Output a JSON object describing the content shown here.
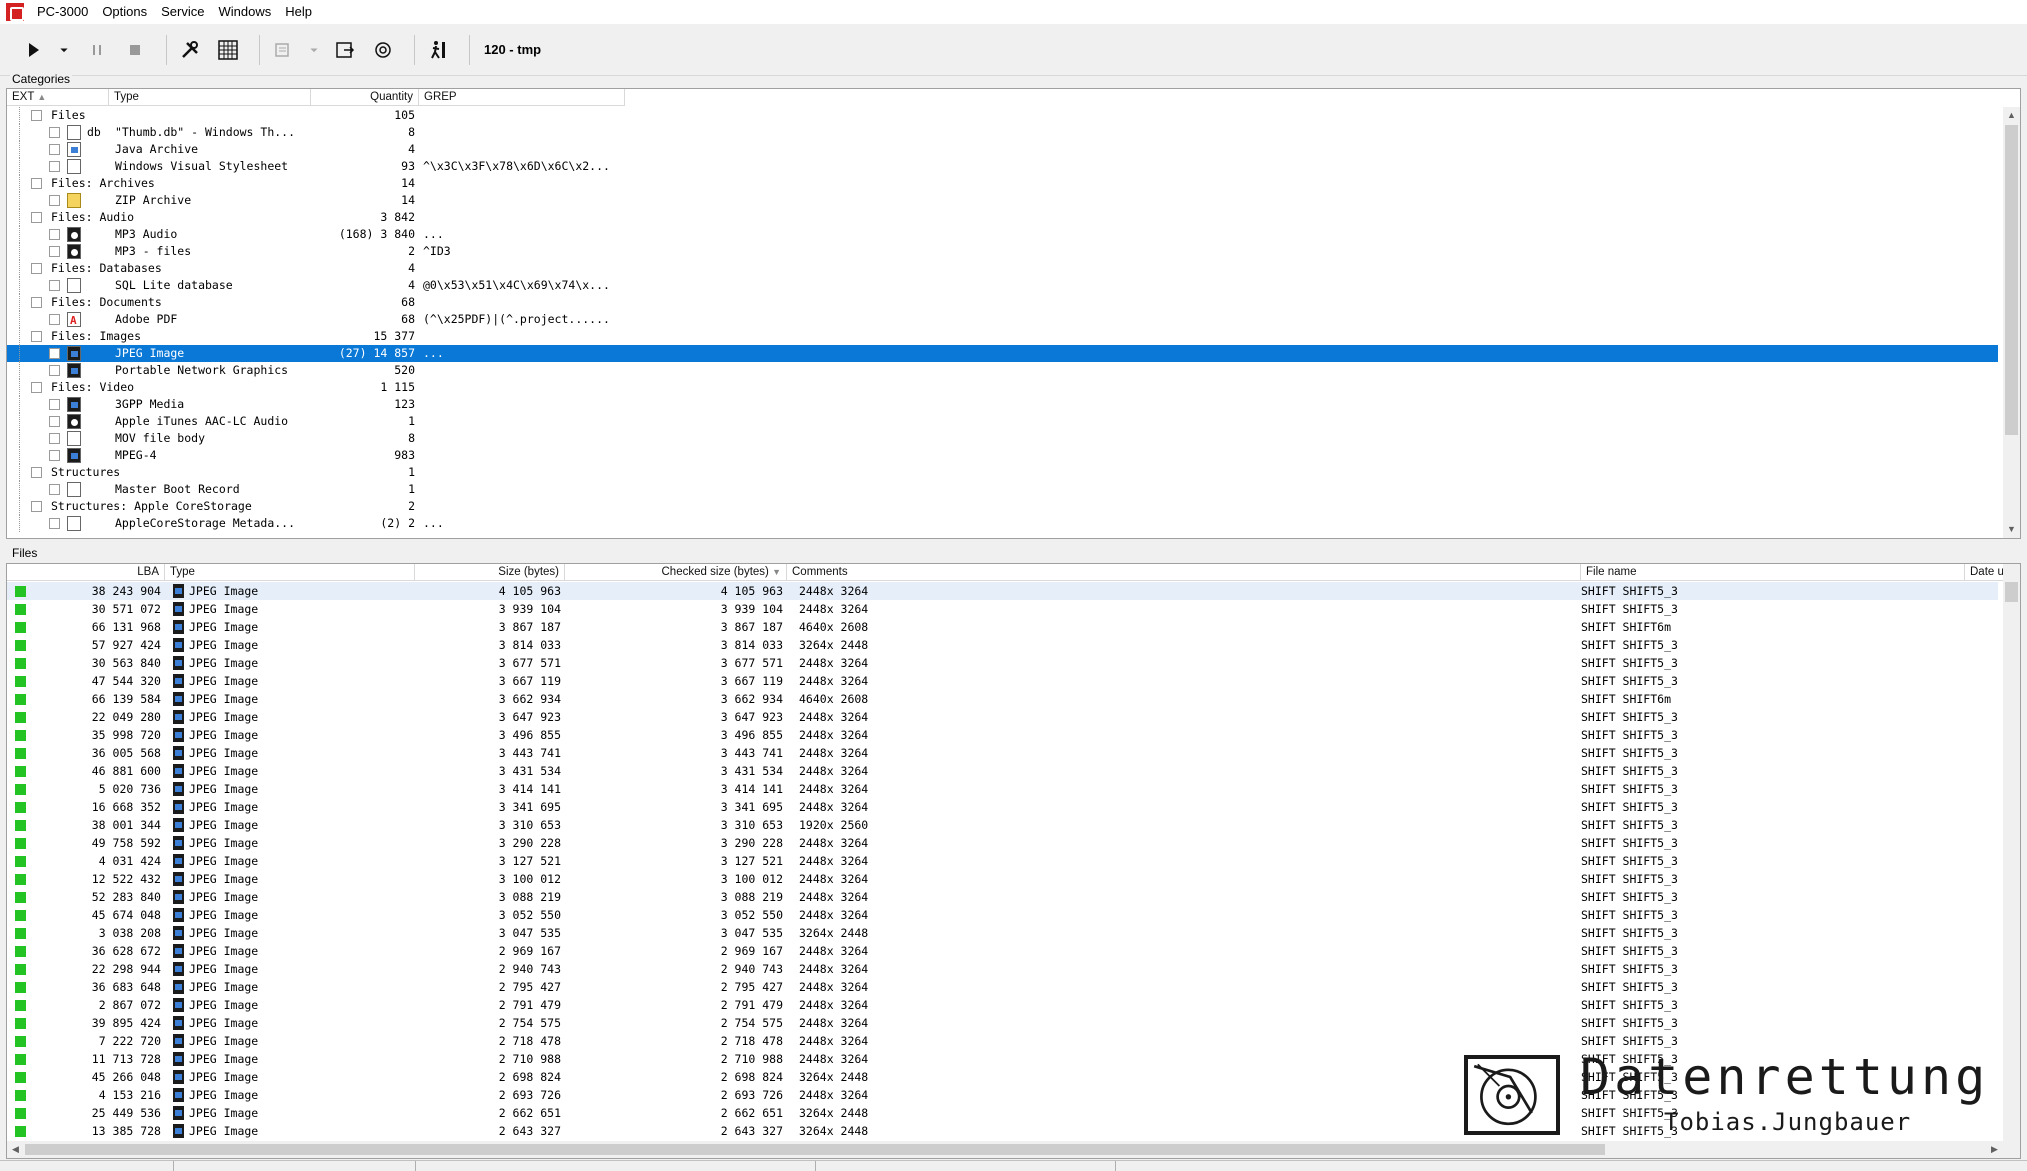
{
  "app": {
    "title": "PC-3000",
    "menu": [
      "Options",
      "Service",
      "Windows",
      "Help"
    ]
  },
  "toolbar": {
    "label": "120 - tmp",
    "icons": [
      "play-icon",
      "dropdown-arrow-icon",
      "pause-icon",
      "stop-icon",
      "tools-icon",
      "grid-icon",
      "list-tool-icon",
      "export-icon",
      "search-config-icon",
      "runner-icon"
    ]
  },
  "categories": {
    "group_title": "Categories",
    "columns": [
      "EXT",
      "Type",
      "Quantity",
      "GREP"
    ],
    "rows": [
      {
        "level": 0,
        "label": "Files",
        "qty": "105",
        "grep": ""
      },
      {
        "level": 1,
        "ext": "db",
        "label": "\"Thumb.db\" - Windows Th...",
        "qty": "8",
        "grep": "",
        "icon": "plain"
      },
      {
        "level": 1,
        "ext": "",
        "label": "Java Archive",
        "qty": "4",
        "grep": "",
        "icon": "java"
      },
      {
        "level": 1,
        "ext": "",
        "label": "Windows Visual Stylesheet",
        "qty": "93",
        "grep": "^\\x3C\\x3F\\x78\\x6D\\x6C\\x2...",
        "icon": "plain"
      },
      {
        "level": 0,
        "label": "Files: Archives",
        "qty": "14",
        "grep": ""
      },
      {
        "level": 1,
        "ext": "",
        "label": "ZIP Archive",
        "qty": "14",
        "grep": "",
        "icon": "zip"
      },
      {
        "level": 0,
        "label": "Files: Audio",
        "qty": "3 842",
        "grep": ""
      },
      {
        "level": 1,
        "ext": "",
        "label": "MP3 Audio",
        "qty": "(168) 3 840",
        "grep": "...",
        "icon": "audio"
      },
      {
        "level": 1,
        "ext": "",
        "label": "MP3 - files",
        "qty": "2",
        "grep": "^ID3",
        "icon": "audio"
      },
      {
        "level": 0,
        "label": "Files: Databases",
        "qty": "4",
        "grep": ""
      },
      {
        "level": 1,
        "ext": "",
        "label": "SQL Lite database",
        "qty": "4",
        "grep": "@0\\x53\\x51\\x4C\\x69\\x74\\x...",
        "icon": "plain"
      },
      {
        "level": 0,
        "label": "Files: Documents",
        "qty": "68",
        "grep": ""
      },
      {
        "level": 1,
        "ext": "",
        "label": "Adobe PDF",
        "qty": "68",
        "grep": "(^\\x25PDF)|(^.project......",
        "icon": "pdf"
      },
      {
        "level": 0,
        "label": "Files: Images",
        "qty": "15 377",
        "grep": ""
      },
      {
        "level": 1,
        "ext": "",
        "label": "JPEG Image",
        "qty": "(27) 14 857",
        "grep": "...",
        "icon": "image",
        "selected": true
      },
      {
        "level": 1,
        "ext": "",
        "label": "Portable Network Graphics",
        "qty": "520",
        "grep": "",
        "icon": "image"
      },
      {
        "level": 0,
        "label": "Files: Video",
        "qty": "1 115",
        "grep": ""
      },
      {
        "level": 1,
        "ext": "",
        "label": "3GPP Media",
        "qty": "123",
        "grep": "",
        "icon": "image"
      },
      {
        "level": 1,
        "ext": "",
        "label": "Apple iTunes AAC-LC Audio",
        "qty": "1",
        "grep": "",
        "icon": "audio"
      },
      {
        "level": 1,
        "ext": "",
        "label": "MOV file body",
        "qty": "8",
        "grep": "",
        "icon": "plain"
      },
      {
        "level": 1,
        "ext": "",
        "label": "MPEG-4",
        "qty": "983",
        "grep": "",
        "icon": "image"
      },
      {
        "level": 0,
        "label": "Structures",
        "qty": "1",
        "grep": ""
      },
      {
        "level": 1,
        "ext": "",
        "label": "Master Boot Record",
        "qty": "1",
        "grep": "",
        "icon": "plain"
      },
      {
        "level": 0,
        "label": "Structures: Apple CoreStorage",
        "qty": "2",
        "grep": ""
      },
      {
        "level": 1,
        "ext": "",
        "label": "AppleCoreStorage Metada...",
        "qty": "(2) 2",
        "grep": "...",
        "icon": "plain"
      }
    ]
  },
  "files": {
    "group_title": "Files",
    "columns": [
      "LBA",
      "Type",
      "Size (bytes)",
      "Checked size (bytes)",
      "Comments",
      "File name",
      "Date u"
    ],
    "rows": [
      [
        "38 243 904",
        "JPEG Image",
        "4 105 963",
        "4 105 963",
        "2448x 3264",
        "SHIFT SHIFT5_3"
      ],
      [
        "30 571 072",
        "JPEG Image",
        "3 939 104",
        "3 939 104",
        "2448x 3264",
        "SHIFT SHIFT5_3"
      ],
      [
        "66 131 968",
        "JPEG Image",
        "3 867 187",
        "3 867 187",
        "4640x 2608",
        "SHIFT SHIFT6m"
      ],
      [
        "57 927 424",
        "JPEG Image",
        "3 814 033",
        "3 814 033",
        "3264x 2448",
        "SHIFT SHIFT5_3"
      ],
      [
        "30 563 840",
        "JPEG Image",
        "3 677 571",
        "3 677 571",
        "2448x 3264",
        "SHIFT SHIFT5_3"
      ],
      [
        "47 544 320",
        "JPEG Image",
        "3 667 119",
        "3 667 119",
        "2448x 3264",
        "SHIFT SHIFT5_3"
      ],
      [
        "66 139 584",
        "JPEG Image",
        "3 662 934",
        "3 662 934",
        "4640x 2608",
        "SHIFT SHIFT6m"
      ],
      [
        "22 049 280",
        "JPEG Image",
        "3 647 923",
        "3 647 923",
        "2448x 3264",
        "SHIFT SHIFT5_3"
      ],
      [
        "35 998 720",
        "JPEG Image",
        "3 496 855",
        "3 496 855",
        "2448x 3264",
        "SHIFT SHIFT5_3"
      ],
      [
        "36 005 568",
        "JPEG Image",
        "3 443 741",
        "3 443 741",
        "2448x 3264",
        "SHIFT SHIFT5_3"
      ],
      [
        "46 881 600",
        "JPEG Image",
        "3 431 534",
        "3 431 534",
        "2448x 3264",
        "SHIFT SHIFT5_3"
      ],
      [
        "5 020 736",
        "JPEG Image",
        "3 414 141",
        "3 414 141",
        "2448x 3264",
        "SHIFT SHIFT5_3"
      ],
      [
        "16 668 352",
        "JPEG Image",
        "3 341 695",
        "3 341 695",
        "2448x 3264",
        "SHIFT SHIFT5_3"
      ],
      [
        "38 001 344",
        "JPEG Image",
        "3 310 653",
        "3 310 653",
        "1920x 2560",
        "SHIFT SHIFT5_3"
      ],
      [
        "49 758 592",
        "JPEG Image",
        "3 290 228",
        "3 290 228",
        "2448x 3264",
        "SHIFT SHIFT5_3"
      ],
      [
        "4 031 424",
        "JPEG Image",
        "3 127 521",
        "3 127 521",
        "2448x 3264",
        "SHIFT SHIFT5_3"
      ],
      [
        "12 522 432",
        "JPEG Image",
        "3 100 012",
        "3 100 012",
        "2448x 3264",
        "SHIFT SHIFT5_3"
      ],
      [
        "52 283 840",
        "JPEG Image",
        "3 088 219",
        "3 088 219",
        "2448x 3264",
        "SHIFT SHIFT5_3"
      ],
      [
        "45 674 048",
        "JPEG Image",
        "3 052 550",
        "3 052 550",
        "2448x 3264",
        "SHIFT SHIFT5_3"
      ],
      [
        "3 038 208",
        "JPEG Image",
        "3 047 535",
        "3 047 535",
        "3264x 2448",
        "SHIFT SHIFT5_3"
      ],
      [
        "36 628 672",
        "JPEG Image",
        "2 969 167",
        "2 969 167",
        "2448x 3264",
        "SHIFT SHIFT5_3"
      ],
      [
        "22 298 944",
        "JPEG Image",
        "2 940 743",
        "2 940 743",
        "2448x 3264",
        "SHIFT SHIFT5_3"
      ],
      [
        "36 683 648",
        "JPEG Image",
        "2 795 427",
        "2 795 427",
        "2448x 3264",
        "SHIFT SHIFT5_3"
      ],
      [
        "2 867 072",
        "JPEG Image",
        "2 791 479",
        "2 791 479",
        "2448x 3264",
        "SHIFT SHIFT5_3"
      ],
      [
        "39 895 424",
        "JPEG Image",
        "2 754 575",
        "2 754 575",
        "2448x 3264",
        "SHIFT SHIFT5_3"
      ],
      [
        "7 222 720",
        "JPEG Image",
        "2 718 478",
        "2 718 478",
        "2448x 3264",
        "SHIFT SHIFT5_3"
      ],
      [
        "11 713 728",
        "JPEG Image",
        "2 710 988",
        "2 710 988",
        "2448x 3264",
        "SHIFT SHIFT5_3"
      ],
      [
        "45 266 048",
        "JPEG Image",
        "2 698 824",
        "2 698 824",
        "3264x 2448",
        "SHIFT SHIFT5_3"
      ],
      [
        "4 153 216",
        "JPEG Image",
        "2 693 726",
        "2 693 726",
        "2448x 3264",
        "SHIFT SHIFT5_3"
      ],
      [
        "25 449 536",
        "JPEG Image",
        "2 662 651",
        "2 662 651",
        "3264x 2448",
        "SHIFT SHIFT5_3"
      ],
      [
        "13 385 728",
        "JPEG Image",
        "2 643 327",
        "2 643 327",
        "3264x 2448",
        "SHIFT SHIFT5_3"
      ]
    ]
  },
  "watermark": {
    "title": "Datenrettung",
    "subtitle": "Tobias.Jungbauer"
  },
  "colors": {
    "selection": "#0a78d7",
    "status_ok": "#22c322"
  }
}
